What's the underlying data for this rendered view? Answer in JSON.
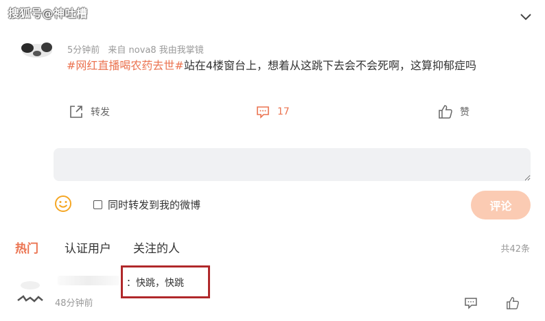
{
  "watermark": "搜狐号@神吐槽",
  "post": {
    "time": "5分钟前",
    "source": "来自 nova8 我由我掌镜",
    "topic": "#网红直播喝农药去世#",
    "text": "站在4楼窗台上，想着从这跳下去会不会死啊，这算抑郁症吗"
  },
  "actions": {
    "forward_label": "转发",
    "comment_count": "17",
    "like_label": "赞"
  },
  "composer": {
    "input_value": "",
    "also_post_label": "同时转发到我的微博",
    "also_post_checked": false,
    "submit_label": "评论"
  },
  "tabs": [
    {
      "label": "热门",
      "active": true
    },
    {
      "label": "认证用户",
      "active": false
    },
    {
      "label": "关注的人",
      "active": false
    }
  ],
  "total_count": "共42条",
  "comments": [
    {
      "text": "：快跳，快跳",
      "time": "48分钟前"
    }
  ],
  "colors": {
    "accent": "#eb7350",
    "submit_disabled": "#fbcbb3",
    "input_bg": "#f0f1f3",
    "emoji": "#f5a623",
    "highlight_box": "#b0282a"
  },
  "icons": [
    "chevron-down-icon",
    "forward-icon",
    "comment-icon",
    "like-icon",
    "emoji-icon",
    "reply-icon"
  ]
}
